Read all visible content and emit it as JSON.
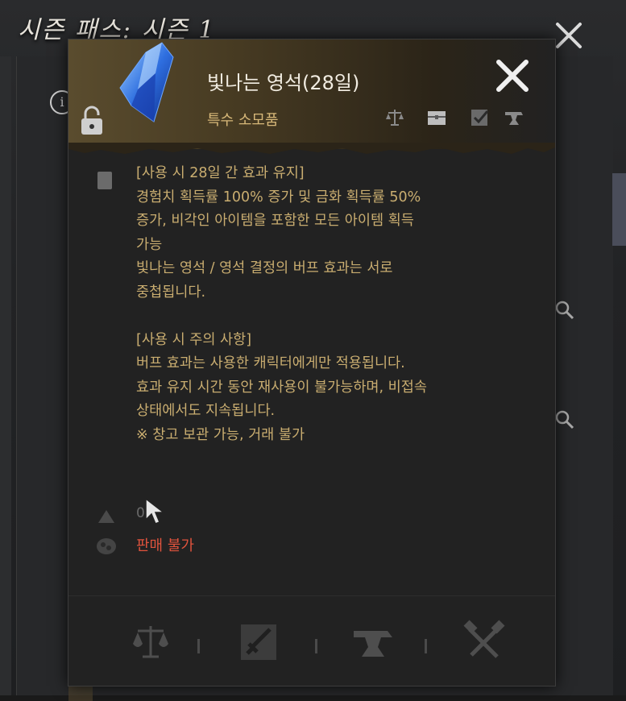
{
  "background": {
    "title": "시즌 패스: 시즌 1"
  },
  "tooltip": {
    "item_name": "빛나는 영석(28일)",
    "item_type": "특수 소모품",
    "description": "[사용 시 28일 간 효과 유지]\n경험치 획득률 100% 증가 및 금화 획득률 50%\n증가, 비각인 아이템을 포함한 모든 아이템 획득\n가능\n빛나는 영석 / 영석 결정의 버프 효과는 서로\n중첩됩니다.\n\n[사용 시 주의 사항]\n버프 효과는 사용한 캐릭터에게만 적용됩니다.\n효과 유지 시간 동안 재사용이 불가능하며, 비접속\n상태에서도 지속됩니다.\n※ 창고 보관 가능, 거래 불가",
    "grade_value": "0",
    "sell_status": "판매 불가"
  },
  "icons": {
    "item": "blue-crystal-icon",
    "lock": "lock-icon",
    "close": "close-icon",
    "header_actions": [
      "scale-icon",
      "storage-chest-icon",
      "checkbox-icon",
      "anvil-icon"
    ],
    "description": "document-icon",
    "grade": "triangle-icon",
    "price": "coin-icon",
    "actions": [
      "scale-icon",
      "sword-upgrade-icon",
      "anvil-icon",
      "hammer-icon"
    ]
  },
  "colors": {
    "description_text": "#c9ad70",
    "item_type": "#d7b879",
    "sell_status": "#e0533d",
    "tooltip_bg": "#222222",
    "header_gold": "#5a4c2e"
  }
}
